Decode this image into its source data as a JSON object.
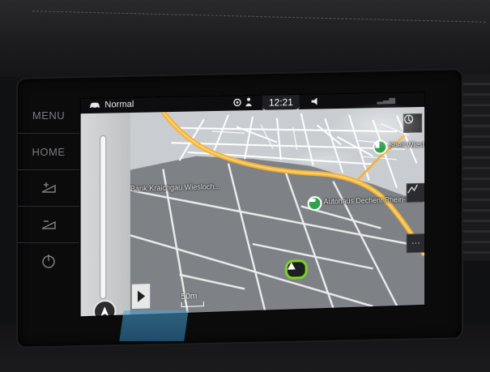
{
  "status": {
    "mode_label": "Normal",
    "clock": "12:21"
  },
  "hardware_buttons": {
    "menu_label": "MENU",
    "home_label": "HOME"
  },
  "map": {
    "labels": {
      "bank": "Bank Kraichgau Wiesloch...",
      "autohaus": "Autohaus Dechent Rhein-Neckar",
      "poi_top": "Shell Wiesl"
    },
    "scale_label": "50m"
  },
  "side_buttons": {
    "more_label": "···"
  },
  "icons": {
    "car": "car-icon",
    "compass": "compass-icon",
    "volume": "speaker-icon",
    "traffic": "traffic-icon",
    "route": "route-icon",
    "more": "more-icon"
  },
  "colors": {
    "main_road": "#f2b23a",
    "position_marker": "#7ed321",
    "poi": "#2ea24a",
    "map_background": "#7e8287"
  }
}
